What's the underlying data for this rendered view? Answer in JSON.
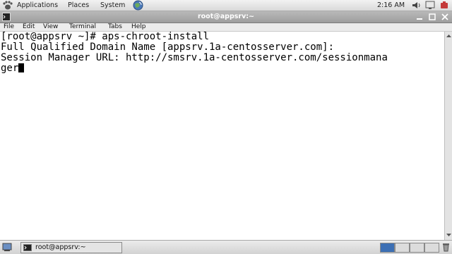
{
  "top_panel": {
    "applications": "Applications",
    "places": "Places",
    "system": "System",
    "clock": "2:16 AM"
  },
  "window": {
    "title": "root@appsrv:~"
  },
  "menu": [
    "File",
    "Edit",
    "View",
    "Terminal",
    "Tabs",
    "Help"
  ],
  "terminal": {
    "lines": [
      "[root@appsrv ~]# aps-chroot-install",
      "Full Qualified Domain Name [appsrv.1a-centosserver.com]:",
      "Session Manager URL: http://smsrv.1a-centosserver.com/sessionmana",
      "ger"
    ]
  },
  "taskbar": {
    "task_label": "root@appsrv:~",
    "active_workspace": 1,
    "workspace_count": 4
  },
  "colors": {
    "active_workspace": "#3c6fb4",
    "workspace": "#dcdcdc",
    "title_text": "#ffffff"
  }
}
